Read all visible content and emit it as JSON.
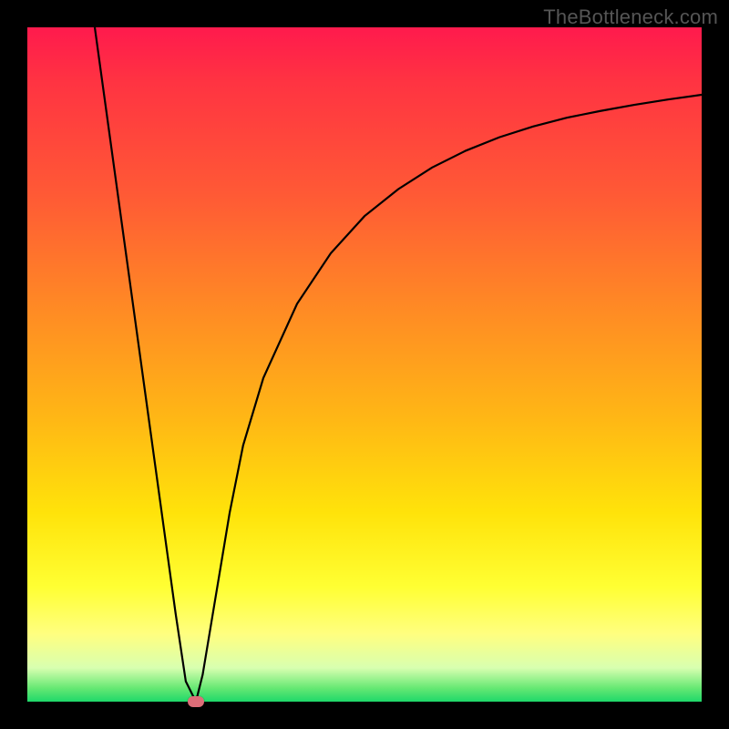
{
  "watermark": {
    "text": "TheBottleneck.com"
  },
  "chart_data": {
    "type": "line",
    "title": "",
    "xlabel": "",
    "ylabel": "",
    "xlim": [
      0,
      100
    ],
    "ylim": [
      0,
      100
    ],
    "grid": false,
    "legend": false,
    "series": [
      {
        "name": "curve",
        "x": [
          10,
          12,
          14,
          16,
          18,
          20,
          22,
          23.5,
          25,
          26,
          27,
          28.5,
          30,
          32,
          35,
          40,
          45,
          50,
          55,
          60,
          65,
          70,
          75,
          80,
          85,
          90,
          95,
          100
        ],
        "values": [
          100,
          85.5,
          71,
          56.5,
          42,
          27.5,
          13,
          3,
          0,
          4,
          10,
          19,
          28,
          38,
          48,
          59,
          66.5,
          72,
          76,
          79.2,
          81.7,
          83.7,
          85.3,
          86.6,
          87.6,
          88.5,
          89.3,
          90
        ]
      }
    ],
    "marker": {
      "x": 25,
      "y": 0,
      "shape": "pill",
      "color": "#dd6d78"
    },
    "background_gradient_top_to_bottom": [
      "#ff1a4d",
      "#ffb715",
      "#ffff33",
      "#1fd86a"
    ]
  }
}
